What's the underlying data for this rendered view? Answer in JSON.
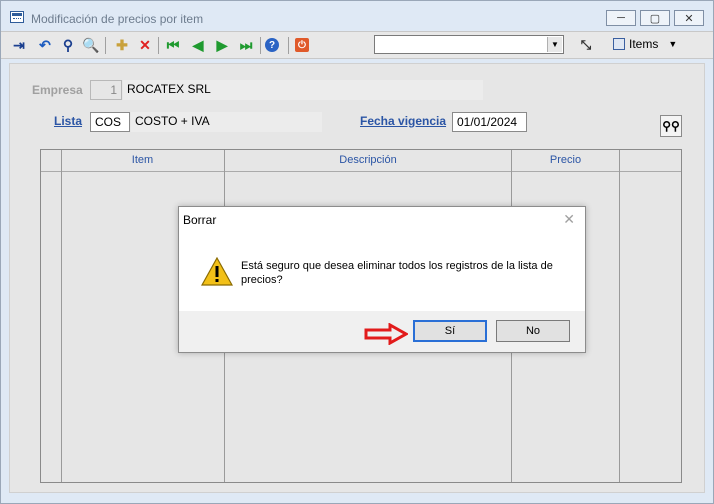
{
  "window": {
    "title": "Modificación de precios por item"
  },
  "window_controls": {
    "minimize": "─",
    "maximize": "▢",
    "close": "✕"
  },
  "toolbar": {
    "items_label": "Items",
    "items_arrow": "▼",
    "combo_value": "",
    "buttons": [
      {
        "name": "exit-icon",
        "glyph": "⇥",
        "color": "#1b3f8f"
      },
      {
        "name": "undo-icon",
        "glyph": "↶",
        "color": "#1b5bbf"
      },
      {
        "name": "find-icon",
        "glyph": "⚲",
        "color": "#1b3f8f"
      },
      {
        "name": "zoom-icon",
        "glyph": "🔍",
        "color": "#3a6ec0"
      },
      {
        "name": "new-icon",
        "glyph": "✚",
        "color": "#c9a13b"
      },
      {
        "name": "delete-icon",
        "glyph": "✕",
        "color": "#e02020"
      },
      {
        "name": "first-icon",
        "glyph": "⏮",
        "color": "#1f9a2f"
      },
      {
        "name": "prev-icon",
        "glyph": "◀",
        "color": "#1f9a2f"
      },
      {
        "name": "next-icon",
        "glyph": "▶",
        "color": "#1f9a2f"
      },
      {
        "name": "last-icon",
        "glyph": "⏭",
        "color": "#1f9a2f"
      },
      {
        "name": "help-icon",
        "glyph": "?",
        "color": "#ffffff"
      },
      {
        "name": "power-icon",
        "glyph": "⏻",
        "color": "#ffffff"
      }
    ]
  },
  "form": {
    "empresa_label": "Empresa",
    "empresa_code": "1",
    "empresa_name": "ROCATEX SRL",
    "lista_label": "Lista",
    "lista_code": "COS",
    "lista_name": "COSTO + IVA",
    "fecha_label": "Fecha vigencia",
    "fecha_value": "01/01/2024"
  },
  "grid": {
    "columns": [
      "Item",
      "Descripción",
      "Precio"
    ]
  },
  "dialog": {
    "title": "Borrar",
    "close": "✕",
    "message": "Está seguro que desea eliminar todos los registros de la lista de precios?",
    "yes_label": "Sí",
    "no_label": "No"
  },
  "colors": {
    "accent_label": "#2b55a5",
    "disabled_label": "#a0a0a0",
    "warning": "#f2c018",
    "annotation_arrow": "#e21b1b"
  }
}
